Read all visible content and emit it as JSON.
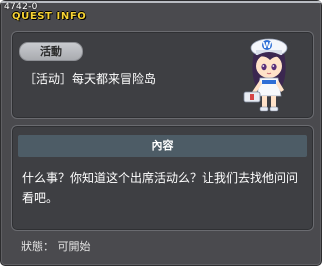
{
  "window": {
    "id": "4742-0",
    "title": "QUEST INFO"
  },
  "quest": {
    "tag": "活動",
    "name": "［活动］每天都来冒险岛"
  },
  "content": {
    "header": "內容",
    "text": "什么事？你知道这个出席活动么？让我们去找他问问看吧。"
  },
  "status": {
    "text": "狀態： 可開始"
  },
  "icons": {
    "npc": "npc-portrait-icon"
  },
  "colors": {
    "title": "#f5d233",
    "window_bg": "#4a4a4e",
    "panel_bg": "#3e3f43",
    "content_header_bg": "#4d5c66"
  }
}
